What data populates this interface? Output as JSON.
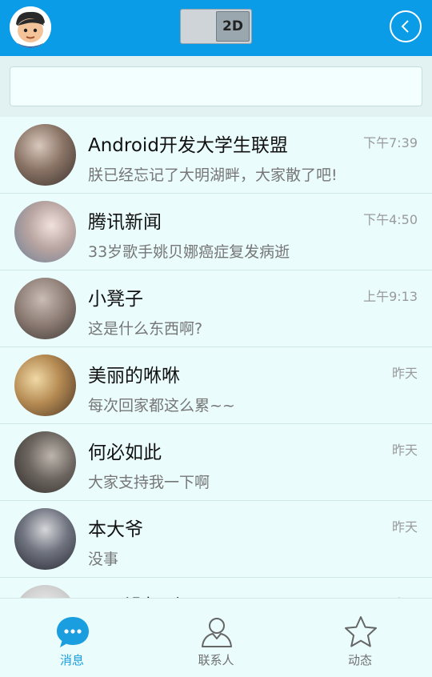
{
  "header": {
    "toggle_label": "2D"
  },
  "search": {
    "placeholder": "",
    "value": ""
  },
  "conversations": [
    {
      "name": "Android开发大学生联盟",
      "preview": "朕已经忘记了大明湖畔，大家散了吧!",
      "time": "下午7:39",
      "avatar_color": "#7a6a60"
    },
    {
      "name": "腾讯新闻",
      "preview": "33岁歌手姚贝娜癌症复发病逝",
      "time": "下午4:50",
      "avatar_color": "#b9a8a2"
    },
    {
      "name": "小凳子",
      "preview": "这是什么东西啊?",
      "time": "上午9:13",
      "avatar_color": "#8b7d76"
    },
    {
      "name": "美丽的咻咻",
      "preview": "每次回家都这么累~~",
      "time": "昨天",
      "avatar_color": "#a37b4f"
    },
    {
      "name": "何必如此",
      "preview": "大家支持我一下啊",
      "time": "昨天",
      "avatar_color": "#5f5a55"
    },
    {
      "name": "本大爷",
      "preview": "没事",
      "time": "昨天",
      "avatar_color": "#4a4d55"
    },
    {
      "name": "万万没想到",
      "preview": "",
      "time": "昨天",
      "avatar_color": "#c9c9c9"
    }
  ],
  "bottom_nav": {
    "messages": "消息",
    "contacts": "联系人",
    "moments": "动态"
  },
  "colors": {
    "header_bg": "#0a9ce6",
    "accent": "#1a9ee0",
    "list_bg": "#eafcfc"
  }
}
